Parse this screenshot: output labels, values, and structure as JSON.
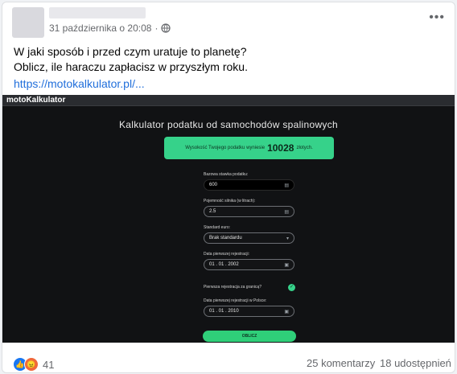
{
  "post": {
    "date": "31 października o 20:08",
    "separator": "·",
    "text_line1": "W jaki sposób i przed czym uratuje to planetę?",
    "text_line2": "Oblicz, ile haraczu zapłacisz w przyszłym roku.",
    "link": "https://motokalkulator.pl/..."
  },
  "calculator": {
    "brand": "motoKalkulator",
    "title": "Kalkulator podatku od samochodów spalinowych",
    "result_prefix": "Wysokość Twojego podatku wyniesie",
    "result_amount": "10028",
    "result_suffix": "złotych.",
    "fields": {
      "base_rate_label": "Bazowa stawka podatku:",
      "base_rate_value": "600",
      "engine_label": "Pojemność silnika (w litrach):",
      "engine_value": "2.5",
      "euro_label": "Standard euro:",
      "euro_value": "Brak standardu",
      "first_reg_label": "Data pierwszej rejestracji:",
      "first_reg_value": "01 . 01 . 2002",
      "abroad_label": "Pierwsza rejestracja za granicą?",
      "poland_reg_label": "Data pierwszej rejestracji w Polsce:",
      "poland_reg_value": "01 . 01 . 2010"
    },
    "button_label": "OBLICZ"
  },
  "footer": {
    "reaction_count": "41",
    "comments": "25 komentarzy",
    "shares": "18 udostępnień"
  },
  "icons": {
    "more": "more-options-icon",
    "globe": "globe-icon",
    "like": "like-reaction-icon",
    "angry": "angry-reaction-icon",
    "calendar": "calendar-icon",
    "chevron": "chevron-down-icon",
    "check": "check-icon"
  },
  "colors": {
    "accent_green": "#36d28a",
    "link_blue": "#216fdb",
    "like_blue": "#1877f2",
    "angry_orange": "#f0683a"
  }
}
